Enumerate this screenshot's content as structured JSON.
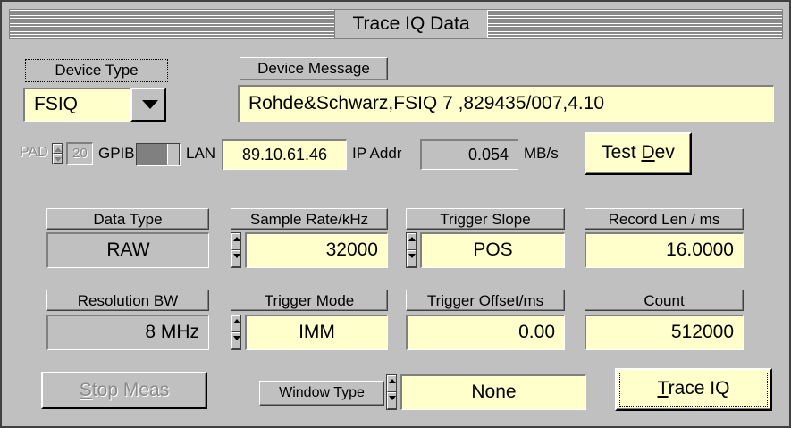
{
  "window": {
    "title": "Trace IQ Data"
  },
  "device": {
    "type_label": "Device Type",
    "type_value": "FSIQ",
    "message_label": "Device Message",
    "message_value": "Rohde&Schwarz,FSIQ 7 ,829435/007,4.10"
  },
  "connection": {
    "pad_label": "PAD",
    "pad_value": "20",
    "gpib_label": "GPIB",
    "lan_label": "LAN",
    "ip_value": "89.10.61.46",
    "ip_label": "IP Addr",
    "rate_value": "0.054",
    "rate_unit": "MB/s",
    "test_button": {
      "prefix": "Test ",
      "mnemonic": "D",
      "suffix": "ev"
    }
  },
  "params": {
    "data_type": {
      "label": "Data Type",
      "value": "RAW"
    },
    "sample_rate": {
      "label": "Sample Rate/kHz",
      "value": "32000"
    },
    "trigger_slope": {
      "label": "Trigger Slope",
      "value": "POS"
    },
    "record_len": {
      "label": "Record Len / ms",
      "value": "16.0000"
    },
    "resolution_bw": {
      "label": "Resolution BW",
      "value": "8 MHz"
    },
    "trigger_mode": {
      "label": "Trigger Mode",
      "value": "IMM"
    },
    "trigger_offset": {
      "label": "Trigger Offset/ms",
      "value": "0.00"
    },
    "count": {
      "label": "Count",
      "value": "512000"
    }
  },
  "footer": {
    "stop_button": {
      "mnemonic": "S",
      "suffix": "top Meas"
    },
    "window_type": {
      "label": "Window Type",
      "value": "None"
    },
    "trace_button": {
      "mnemonic": "T",
      "suffix": "race IQ"
    }
  },
  "colors": {
    "panel": "#c0c0c0",
    "field": "#ffffcc",
    "disabled_text": "#8a8a8a"
  }
}
